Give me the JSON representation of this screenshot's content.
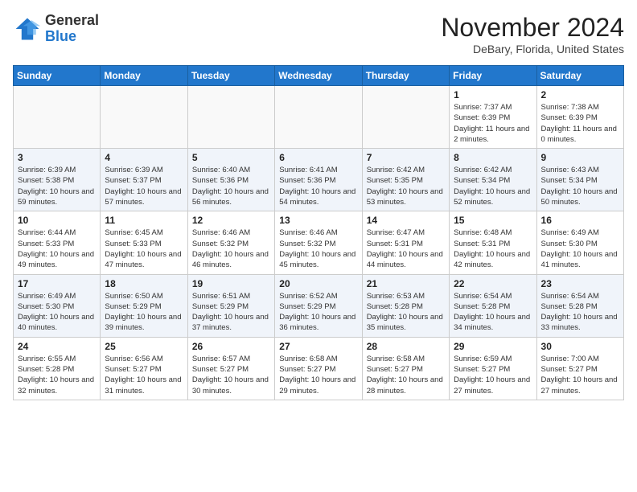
{
  "logo": {
    "text_general": "General",
    "text_blue": "Blue"
  },
  "header": {
    "month": "November 2024",
    "location": "DeBary, Florida, United States"
  },
  "weekdays": [
    "Sunday",
    "Monday",
    "Tuesday",
    "Wednesday",
    "Thursday",
    "Friday",
    "Saturday"
  ],
  "weeks": [
    [
      {
        "day": "",
        "info": ""
      },
      {
        "day": "",
        "info": ""
      },
      {
        "day": "",
        "info": ""
      },
      {
        "day": "",
        "info": ""
      },
      {
        "day": "",
        "info": ""
      },
      {
        "day": "1",
        "info": "Sunrise: 7:37 AM\nSunset: 6:39 PM\nDaylight: 11 hours and 2 minutes."
      },
      {
        "day": "2",
        "info": "Sunrise: 7:38 AM\nSunset: 6:39 PM\nDaylight: 11 hours and 0 minutes."
      }
    ],
    [
      {
        "day": "3",
        "info": "Sunrise: 6:39 AM\nSunset: 5:38 PM\nDaylight: 10 hours and 59 minutes."
      },
      {
        "day": "4",
        "info": "Sunrise: 6:39 AM\nSunset: 5:37 PM\nDaylight: 10 hours and 57 minutes."
      },
      {
        "day": "5",
        "info": "Sunrise: 6:40 AM\nSunset: 5:36 PM\nDaylight: 10 hours and 56 minutes."
      },
      {
        "day": "6",
        "info": "Sunrise: 6:41 AM\nSunset: 5:36 PM\nDaylight: 10 hours and 54 minutes."
      },
      {
        "day": "7",
        "info": "Sunrise: 6:42 AM\nSunset: 5:35 PM\nDaylight: 10 hours and 53 minutes."
      },
      {
        "day": "8",
        "info": "Sunrise: 6:42 AM\nSunset: 5:34 PM\nDaylight: 10 hours and 52 minutes."
      },
      {
        "day": "9",
        "info": "Sunrise: 6:43 AM\nSunset: 5:34 PM\nDaylight: 10 hours and 50 minutes."
      }
    ],
    [
      {
        "day": "10",
        "info": "Sunrise: 6:44 AM\nSunset: 5:33 PM\nDaylight: 10 hours and 49 minutes."
      },
      {
        "day": "11",
        "info": "Sunrise: 6:45 AM\nSunset: 5:33 PM\nDaylight: 10 hours and 47 minutes."
      },
      {
        "day": "12",
        "info": "Sunrise: 6:46 AM\nSunset: 5:32 PM\nDaylight: 10 hours and 46 minutes."
      },
      {
        "day": "13",
        "info": "Sunrise: 6:46 AM\nSunset: 5:32 PM\nDaylight: 10 hours and 45 minutes."
      },
      {
        "day": "14",
        "info": "Sunrise: 6:47 AM\nSunset: 5:31 PM\nDaylight: 10 hours and 44 minutes."
      },
      {
        "day": "15",
        "info": "Sunrise: 6:48 AM\nSunset: 5:31 PM\nDaylight: 10 hours and 42 minutes."
      },
      {
        "day": "16",
        "info": "Sunrise: 6:49 AM\nSunset: 5:30 PM\nDaylight: 10 hours and 41 minutes."
      }
    ],
    [
      {
        "day": "17",
        "info": "Sunrise: 6:49 AM\nSunset: 5:30 PM\nDaylight: 10 hours and 40 minutes."
      },
      {
        "day": "18",
        "info": "Sunrise: 6:50 AM\nSunset: 5:29 PM\nDaylight: 10 hours and 39 minutes."
      },
      {
        "day": "19",
        "info": "Sunrise: 6:51 AM\nSunset: 5:29 PM\nDaylight: 10 hours and 37 minutes."
      },
      {
        "day": "20",
        "info": "Sunrise: 6:52 AM\nSunset: 5:29 PM\nDaylight: 10 hours and 36 minutes."
      },
      {
        "day": "21",
        "info": "Sunrise: 6:53 AM\nSunset: 5:28 PM\nDaylight: 10 hours and 35 minutes."
      },
      {
        "day": "22",
        "info": "Sunrise: 6:54 AM\nSunset: 5:28 PM\nDaylight: 10 hours and 34 minutes."
      },
      {
        "day": "23",
        "info": "Sunrise: 6:54 AM\nSunset: 5:28 PM\nDaylight: 10 hours and 33 minutes."
      }
    ],
    [
      {
        "day": "24",
        "info": "Sunrise: 6:55 AM\nSunset: 5:28 PM\nDaylight: 10 hours and 32 minutes."
      },
      {
        "day": "25",
        "info": "Sunrise: 6:56 AM\nSunset: 5:27 PM\nDaylight: 10 hours and 31 minutes."
      },
      {
        "day": "26",
        "info": "Sunrise: 6:57 AM\nSunset: 5:27 PM\nDaylight: 10 hours and 30 minutes."
      },
      {
        "day": "27",
        "info": "Sunrise: 6:58 AM\nSunset: 5:27 PM\nDaylight: 10 hours and 29 minutes."
      },
      {
        "day": "28",
        "info": "Sunrise: 6:58 AM\nSunset: 5:27 PM\nDaylight: 10 hours and 28 minutes."
      },
      {
        "day": "29",
        "info": "Sunrise: 6:59 AM\nSunset: 5:27 PM\nDaylight: 10 hours and 27 minutes."
      },
      {
        "day": "30",
        "info": "Sunrise: 7:00 AM\nSunset: 5:27 PM\nDaylight: 10 hours and 27 minutes."
      }
    ]
  ]
}
